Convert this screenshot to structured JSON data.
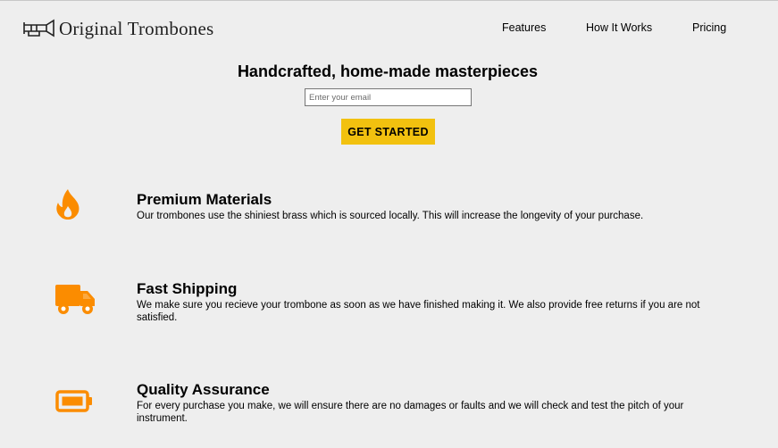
{
  "header": {
    "logo_text": "Original Trombones",
    "logo_icon": "trombone-icon",
    "nav": [
      {
        "label": "Features"
      },
      {
        "label": "How It Works"
      },
      {
        "label": "Pricing"
      }
    ]
  },
  "hero": {
    "title": "Handcrafted, home-made masterpieces",
    "email_placeholder": "Enter your email",
    "email_value": "",
    "cta_label": "GET STARTED"
  },
  "features": [
    {
      "icon": "fire-icon",
      "title": "Premium Materials",
      "description": "Our trombones use the shiniest brass which is sourced locally. This will increase the longevity of your purchase."
    },
    {
      "icon": "truck-icon",
      "title": "Fast Shipping",
      "description": "We make sure you recieve your trombone as soon as we have finished making it. We also provide free returns if you are not satisfied."
    },
    {
      "icon": "battery-icon",
      "title": "Quality Assurance",
      "description": "For every purchase you make, we will ensure there are no damages or faults and we will check and test the pitch of your instrument."
    }
  ],
  "colors": {
    "background": "#eeeeee",
    "accent_button": "#f2c10f",
    "icon_orange": "#fb8c00"
  }
}
